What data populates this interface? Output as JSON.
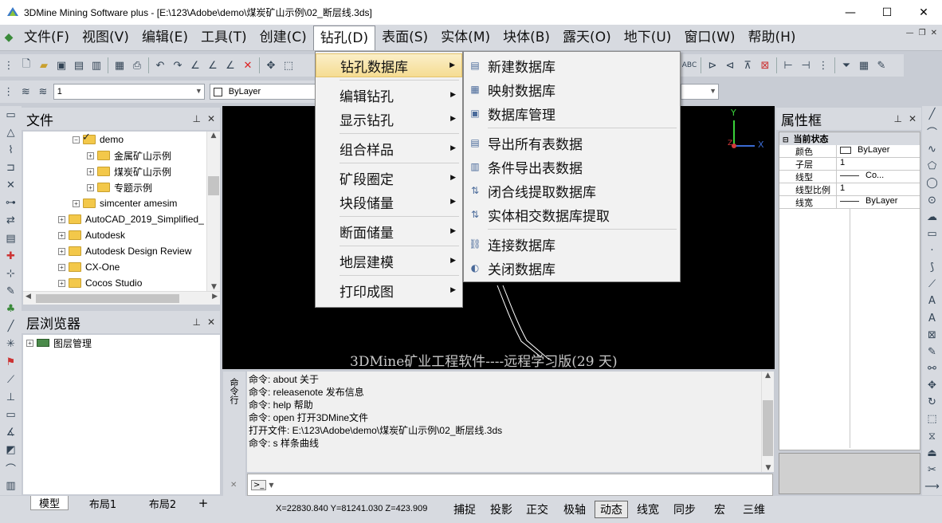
{
  "window": {
    "title": "3DMine Mining Software plus - [E:\\123\\Adobe\\demo\\煤炭矿山示例\\02_断层线.3ds]",
    "minimize": "—",
    "maximize": "☐",
    "close": "✕"
  },
  "menubar": {
    "items": [
      "文件(F)",
      "视图(V)",
      "编辑(E)",
      "工具(T)",
      "创建(C)",
      "钻孔(D)",
      "表面(S)",
      "实体(M)",
      "块体(B)",
      "露天(O)",
      "地下(U)",
      "窗口(W)",
      "帮助(H)"
    ],
    "active_index": 5
  },
  "layer_toolbar": {
    "layer_value": "1",
    "color_value": "ByLayer"
  },
  "file_panel": {
    "title": "文件",
    "tree": [
      {
        "label": "demo",
        "level": 2,
        "expander": "−",
        "icon": "checked-folder"
      },
      {
        "label": "金属矿山示例",
        "level": 3,
        "expander": "+",
        "icon": "folder"
      },
      {
        "label": "煤炭矿山示例",
        "level": 3,
        "expander": "+",
        "icon": "folder"
      },
      {
        "label": "专题示例",
        "level": 3,
        "expander": "+",
        "icon": "folder"
      },
      {
        "label": "simcenter amesim",
        "level": 2,
        "expander": "+",
        "icon": "folder"
      },
      {
        "label": "AutoCAD_2019_Simplified_",
        "level": 1,
        "expander": "+",
        "icon": "folder"
      },
      {
        "label": "Autodesk",
        "level": 1,
        "expander": "+",
        "icon": "folder"
      },
      {
        "label": "Autodesk Design Review",
        "level": 1,
        "expander": "+",
        "icon": "folder"
      },
      {
        "label": "CX-One",
        "level": 1,
        "expander": "+",
        "icon": "folder"
      },
      {
        "label": "Cocos Studio",
        "level": 1,
        "expander": "+",
        "icon": "folder"
      }
    ]
  },
  "layer_panel": {
    "title": "层浏览器",
    "root": "图层管理"
  },
  "drill_menu": {
    "items": [
      {
        "label": "钻孔数据库",
        "has_sub": true,
        "highlighted": true
      },
      {
        "label": "编辑钻孔",
        "has_sub": true,
        "sep_before": true
      },
      {
        "label": "显示钻孔",
        "has_sub": true
      },
      {
        "label": "组合样品",
        "has_sub": true,
        "sep_before": true
      },
      {
        "label": "矿段圈定",
        "has_sub": true,
        "sep_before": true
      },
      {
        "label": "块段储量",
        "has_sub": true
      },
      {
        "label": "断面储量",
        "has_sub": true,
        "sep_before": true
      },
      {
        "label": "地层建模",
        "has_sub": true,
        "sep_before": true
      },
      {
        "label": "打印成图",
        "has_sub": true,
        "sep_before": true
      }
    ]
  },
  "db_submenu": {
    "items": [
      {
        "label": "新建数据库",
        "icon": "new-db-icon"
      },
      {
        "label": "映射数据库",
        "icon": "map-db-icon"
      },
      {
        "label": "数据库管理",
        "icon": "db-manage-icon"
      },
      {
        "label": "导出所有表数据",
        "icon": "export-all-icon",
        "sep_before": true
      },
      {
        "label": "条件导出表数据",
        "icon": "export-cond-icon"
      },
      {
        "label": "闭合线提取数据库",
        "icon": "closed-line-icon"
      },
      {
        "label": "实体相交数据库提取",
        "icon": "solid-intersect-icon"
      },
      {
        "label": "连接数据库",
        "icon": "connect-db-icon",
        "sep_before": true
      },
      {
        "label": "关闭数据库",
        "icon": "close-db-icon"
      }
    ]
  },
  "canvas": {
    "watermark": "3DMine矿业工程软件----远程学习版(29 天)",
    "axis_y": "Y",
    "axis_x": "X",
    "axis_z": "Z"
  },
  "properties": {
    "title": "属性框",
    "section": "当前状态",
    "rows": [
      {
        "key": "颜色",
        "value": "ByLayer"
      },
      {
        "key": "子层",
        "value": "1"
      },
      {
        "key": "线型",
        "value": "Co..."
      },
      {
        "key": "线型比例",
        "value": "1"
      },
      {
        "key": "线宽",
        "value": "ByLayer"
      }
    ]
  },
  "command": {
    "side_label": "命令行",
    "lines": [
      "命令: about  关于",
      "命令: releasenote  发布信息",
      "命令: help  帮助",
      "命令: open  打开3DMine文件",
      "打开文件: E:\\123\\Adobe\\demo\\煤炭矿山示例\\02_断层线.3ds",
      "命令: s  样条曲线"
    ],
    "prompt": ">_"
  },
  "tabs": [
    "模型",
    "布局1",
    "布局2"
  ],
  "status": {
    "coords": "X=22830.840 Y=81241.030 Z=423.909",
    "buttons": [
      "捕捉",
      "投影",
      "正交",
      "极轴",
      "动态",
      "线宽",
      "同步",
      "宏",
      "三维"
    ],
    "pressed_index": 4
  },
  "colors": {
    "chrome": "#d7dae0",
    "canvas": "#000000",
    "menu_highlight": "#f5dc92"
  }
}
